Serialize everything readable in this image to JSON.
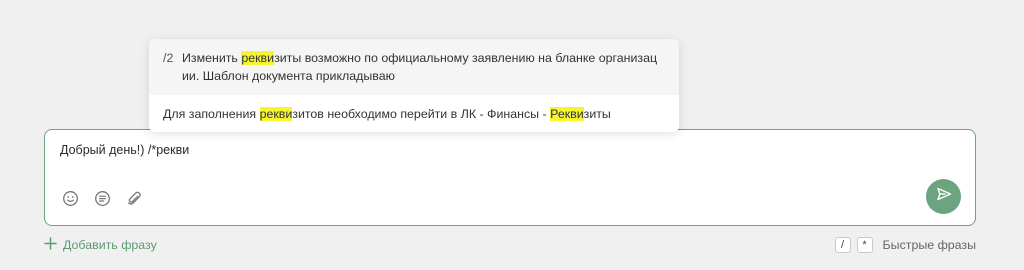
{
  "suggestions": [
    {
      "number": "/2",
      "parts": [
        "Изменить ",
        "рекви",
        "зиты возможно по официальному заявлению на бланке организации. Шаблон документа прикладываю"
      ],
      "highlighted": [
        false,
        true,
        false
      ]
    },
    {
      "number": "",
      "parts": [
        "Для заполнения ",
        "рекви",
        "зитов необходимо перейти в ЛК - Финансы - ",
        "Рекви",
        "зиты"
      ],
      "highlighted": [
        false,
        true,
        false,
        true,
        false
      ]
    }
  ],
  "composer": {
    "text": "Добрый день!) /*рекви",
    "tools": [
      "smiley-icon",
      "template-list-icon",
      "paperclip-icon"
    ],
    "send_icon": "send-icon"
  },
  "footer": {
    "add_phrase_label": "Добавить фразу",
    "key_slash": "/",
    "key_star": "*",
    "quick_phrases_label": "Быстрые фразы"
  },
  "colors": {
    "accent": "#6aa57f",
    "highlight": "#f5f532",
    "background": "#f0f0f0"
  }
}
